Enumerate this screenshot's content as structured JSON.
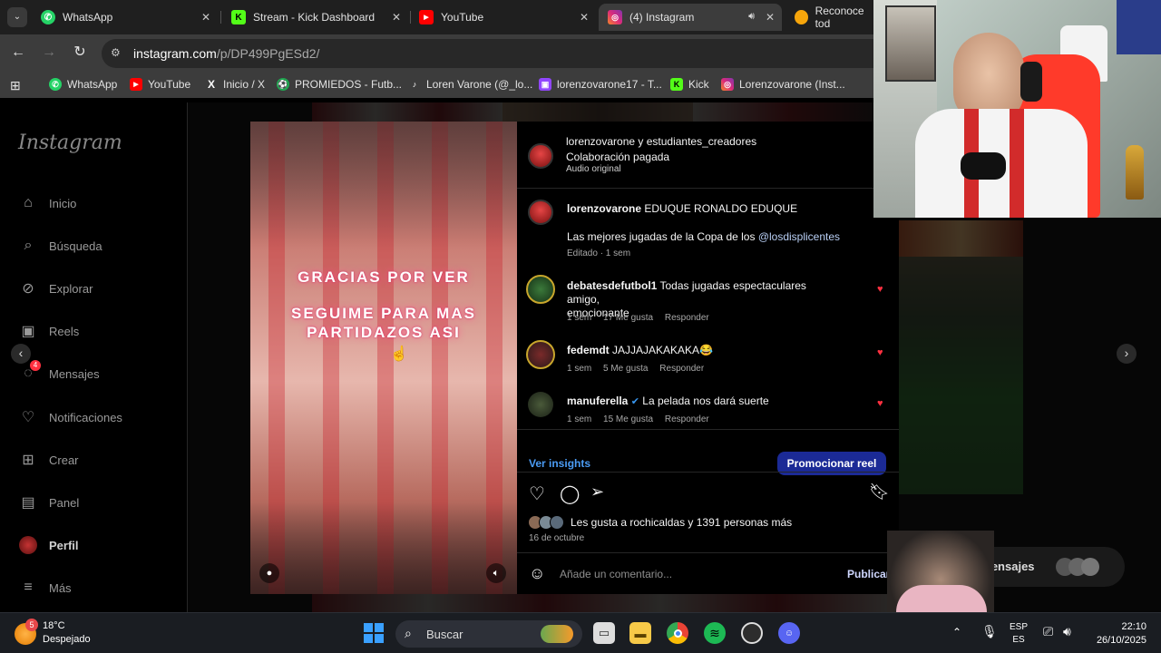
{
  "browser": {
    "tabs": [
      {
        "title": "WhatsApp",
        "favicon": "whatsapp-icon",
        "color": "#25d366"
      },
      {
        "title": "Stream - Kick Dashboard",
        "favicon": "kick-icon",
        "color": "#53fc18"
      },
      {
        "title": "YouTube",
        "favicon": "youtube-icon",
        "color": "#ff0000"
      },
      {
        "title": "(4) Instagram",
        "favicon": "instagram-icon",
        "color": "#e1306c",
        "active": true
      },
      {
        "title": "Reconoce tod",
        "favicon": "bulb-icon",
        "color": "#f6a50b"
      }
    ],
    "url_host": "instagram.com",
    "url_path": "/p/DP499PgESd2/",
    "bookmarks": [
      {
        "label": "WhatsApp",
        "icon": "whatsapp-icon",
        "color": "#25d366"
      },
      {
        "label": "YouTube",
        "icon": "youtube-icon",
        "color": "#ff0000"
      },
      {
        "label": "Inicio / X",
        "icon": "x-icon",
        "color": "#ffffff"
      },
      {
        "label": "PROMIEDOS - Futb...",
        "icon": "promiedos-icon",
        "color": "#1fa750"
      },
      {
        "label": "Loren Varone (@_lo...",
        "icon": "tiktok-icon",
        "color": "#ffffff"
      },
      {
        "label": "lorenzovarone17 - T...",
        "icon": "twitch-icon",
        "color": "#9146ff"
      },
      {
        "label": "Kick",
        "icon": "kick-icon",
        "color": "#53fc18"
      },
      {
        "label": "Lorenzovarone (Inst...",
        "icon": "instagram-icon",
        "color": "#e1306c"
      }
    ]
  },
  "instagram": {
    "logo": "Instagram",
    "nav": [
      {
        "label": "Inicio",
        "icon": "home-icon"
      },
      {
        "label": "Búsqueda",
        "icon": "search-icon"
      },
      {
        "label": "Explorar",
        "icon": "compass-icon"
      },
      {
        "label": "Reels",
        "icon": "reels-icon"
      },
      {
        "label": "Mensajes",
        "icon": "messenger-icon",
        "badge": "4"
      },
      {
        "label": "Notificaciones",
        "icon": "heart-icon"
      },
      {
        "label": "Crear",
        "icon": "plus-square-icon"
      },
      {
        "label": "Panel",
        "icon": "chart-icon"
      },
      {
        "label": "Perfil",
        "icon": "profile-avatar",
        "bold": true
      },
      {
        "label": "Más",
        "icon": "menu-icon"
      }
    ],
    "video": {
      "line1": "GRACIAS POR VER",
      "line2a": "SEGUIME PARA MAS",
      "line2b": "PARTIDAZOS ASI"
    },
    "post": {
      "header_users": "lorenzovarone y estudiantes_creadores",
      "header_paid": "Colaboración pagada",
      "header_audio": "Audio original",
      "caption_user": "lorenzovarone",
      "caption_text": "EDUQUE RONALDO EDUQUE",
      "caption_line2": "Las mejores jugadas de la Copa de los",
      "caption_mention": "@losdisplicentes",
      "caption_meta": "Editado · 1 sem",
      "comments": [
        {
          "user": "debatesdefutbol1",
          "text": "Todas jugadas espectaculares amigo,",
          "text2": "emocionante",
          "time": "1 sem",
          "likes": "17 Me gusta",
          "reply": "Responder"
        },
        {
          "user": "fedemdt",
          "text": "JAJJAJAKAKAKA😂",
          "time": "1 sem",
          "likes": "5 Me gusta",
          "reply": "Responder"
        },
        {
          "user": "manuferella",
          "text": "La pelada nos dará suerte",
          "time": "1 sem",
          "likes": "15 Me gusta",
          "reply": "Responder",
          "verified": true
        }
      ],
      "insights": "Ver insights",
      "promote": "Promocionar reel",
      "likes_text": "Les gusta a rochicaldas y 1391 personas más",
      "date": "16 de octubre",
      "comment_placeholder": "Añade un comentario...",
      "publish": "Publicar"
    },
    "messages_bar": "Mensajes",
    "messages_badge": "4"
  },
  "taskbar": {
    "weather_temp": "18°C",
    "weather_desc": "Despejado",
    "weather_badge": "5",
    "search": "Buscar",
    "lang1": "ESP",
    "lang2": "ES",
    "time": "22:10",
    "date": "26/10/2025"
  }
}
